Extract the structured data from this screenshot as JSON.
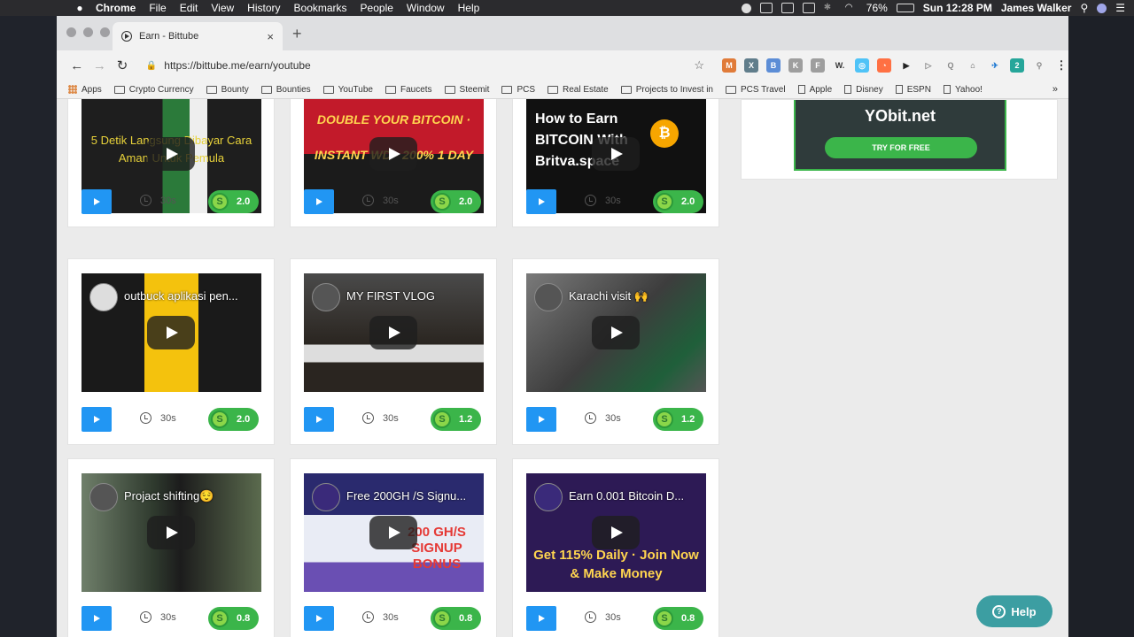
{
  "menubar": {
    "app": "Chrome",
    "items": [
      "File",
      "Edit",
      "View",
      "History",
      "Bookmarks",
      "People",
      "Window",
      "Help"
    ],
    "battery": "76%",
    "clock": "Sun 12:28 PM",
    "user": "James Walker"
  },
  "tab": {
    "title": "Earn - Bittube",
    "close": "×",
    "new_tab": "+"
  },
  "toolbar": {
    "url": "https://bittube.me/earn/youtube",
    "back": "←",
    "forward": "→",
    "reload": "↻",
    "star": "☆",
    "menu": "⋮",
    "extensions": [
      "M",
      "X",
      "B",
      "K",
      "F",
      "W.",
      "◎",
      "◔",
      "▶",
      "▷",
      "Q",
      "⌂",
      "✈",
      "2",
      "⚲"
    ]
  },
  "bookmarks": {
    "items": [
      {
        "label": "Apps",
        "icon": "apps"
      },
      {
        "label": "Crypto Currency",
        "icon": "folder"
      },
      {
        "label": "Bounty",
        "icon": "folder"
      },
      {
        "label": "Bounties",
        "icon": "folder"
      },
      {
        "label": "YouTube",
        "icon": "folder"
      },
      {
        "label": "Faucets",
        "icon": "folder"
      },
      {
        "label": "Steemit",
        "icon": "folder"
      },
      {
        "label": "PCS",
        "icon": "folder"
      },
      {
        "label": "Real Estate",
        "icon": "folder"
      },
      {
        "label": "Projects to Invest in",
        "icon": "folder"
      },
      {
        "label": "PCS Travel",
        "icon": "folder"
      },
      {
        "label": "Apple",
        "icon": "page"
      },
      {
        "label": "Disney",
        "icon": "page"
      },
      {
        "label": "ESPN",
        "icon": "page"
      },
      {
        "label": "Yahoo!",
        "icon": "page"
      }
    ],
    "more": "»"
  },
  "ad": {
    "brand": "YObit.net",
    "cta": "TRY FOR FREE"
  },
  "videos": [
    {
      "title": "",
      "overlay": "5 Detik Langsung Dibayar Cara Aman Untuk Pemula",
      "duration": "30s",
      "reward": "2.0"
    },
    {
      "title": "",
      "overlay": "DOUBLE YOUR BITCOIN · INSTANT WD · 200% 1 DAY",
      "duration": "30s",
      "reward": "2.0"
    },
    {
      "title": "",
      "overlay": "How to Earn BITCOIN With Britva.space",
      "duration": "30s",
      "reward": "2.0"
    },
    {
      "title": "outbuck aplikasi pen...",
      "overlay": "",
      "duration": "30s",
      "reward": "2.0"
    },
    {
      "title": "MY FIRST VLOG",
      "overlay": "",
      "duration": "30s",
      "reward": "1.2"
    },
    {
      "title": "Karachi visit 🙌",
      "overlay": "",
      "duration": "30s",
      "reward": "1.2"
    },
    {
      "title": "Projact shifting😌",
      "overlay": "",
      "duration": "30s",
      "reward": "0.8"
    },
    {
      "title": "Free 200GH /S Signu...",
      "overlay": "200 GH/S SIGNUP BONUS",
      "duration": "30s",
      "reward": "0.8"
    },
    {
      "title": "Earn 0.001 Bitcoin D...",
      "overlay": "Get 115% Daily · Join Now & Make Money",
      "duration": "30s",
      "reward": "0.8"
    }
  ],
  "help": {
    "label": "Help",
    "icon": "?"
  },
  "colors": {
    "play_button": "#2196f3",
    "reward": "#3bb54a",
    "help": "#3c9ea2"
  }
}
